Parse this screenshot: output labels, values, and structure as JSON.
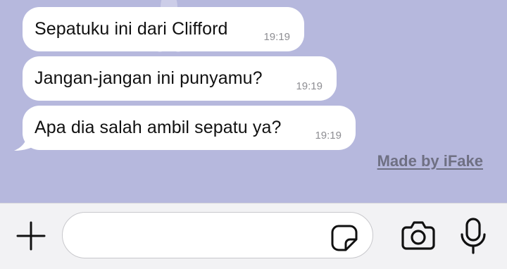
{
  "messages": [
    {
      "text": "Sepatuku ini dari Clifford",
      "time": "19:19"
    },
    {
      "text": "Jangan-jangan ini punyamu?",
      "time": "19:19"
    },
    {
      "text": "Apa dia salah ambil sepatu ya?",
      "time": "19:19"
    }
  ],
  "watermark": "Made by iFake",
  "input": {
    "value": "",
    "placeholder": ""
  },
  "icons": {
    "add": "plus-icon",
    "sticker": "sticker-icon",
    "camera": "camera-icon",
    "microphone": "microphone-icon"
  },
  "colors": {
    "chat_background": "#b6b8dd",
    "bubble": "#ffffff",
    "timestamp": "#8e8e93",
    "input_bar": "#f2f2f4"
  }
}
